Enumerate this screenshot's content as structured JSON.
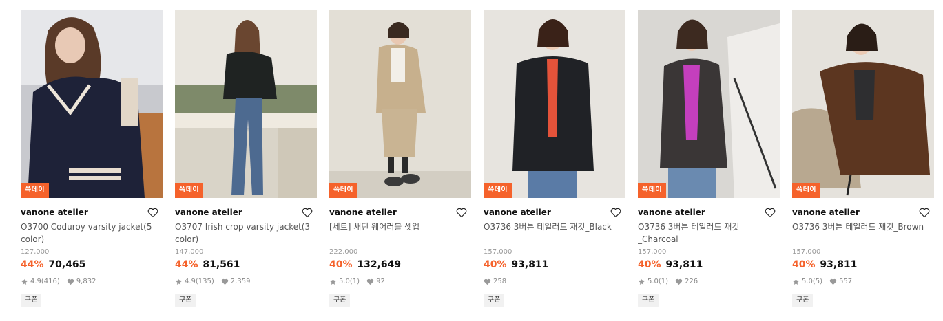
{
  "products": [
    {
      "badge": "쓱데이",
      "brand": "vanone atelier",
      "name": "O3700 Coduroy varsity jacket(5 color)",
      "original_price": "127,000",
      "discount": "44%",
      "price": "70,465",
      "rating": "4.9",
      "reviews": "(416)",
      "likes": "9,832",
      "coupon": "쿠폰"
    },
    {
      "badge": "쓱데이",
      "brand": "vanone atelier",
      "name": "O3707 Irish crop varsity jacket(3 color)",
      "original_price": "147,000",
      "discount": "44%",
      "price": "81,561",
      "rating": "4.9",
      "reviews": "(135)",
      "likes": "2,359",
      "coupon": "쿠폰"
    },
    {
      "badge": "쓱데이",
      "brand": "vanone atelier",
      "name": "[세트] 새틴 웨어러블 셋업",
      "original_price": "222,000",
      "discount": "40%",
      "price": "132,649",
      "rating": "5.0",
      "reviews": "(1)",
      "likes": "92",
      "coupon": "쿠폰"
    },
    {
      "badge": "쓱데이",
      "brand": "vanone atelier",
      "name": "O3736 3버튼 테일러드 재킷_Black",
      "original_price": "157,000",
      "discount": "40%",
      "price": "93,811",
      "rating": "",
      "reviews": "",
      "likes": "258",
      "coupon": "쿠폰"
    },
    {
      "badge": "쓱데이",
      "brand": "vanone atelier",
      "name": "O3736 3버튼 테일러드 재킷 _Charcoal",
      "original_price": "157,000",
      "discount": "40%",
      "price": "93,811",
      "rating": "5.0",
      "reviews": "(1)",
      "likes": "226",
      "coupon": "쿠폰"
    },
    {
      "badge": "쓱데이",
      "brand": "vanone atelier",
      "name": "O3736 3버튼 테일러드 재킷_Brown",
      "original_price": "157,000",
      "discount": "40%",
      "price": "93,811",
      "rating": "5.0",
      "reviews": "(5)",
      "likes": "557",
      "coupon": "쿠폰"
    }
  ],
  "colors": {
    "accent": "#f5622b",
    "text": "#111111",
    "muted": "#888888"
  },
  "icons": {
    "wishlist": "heart-outline-icon",
    "rating": "star-icon",
    "likes": "heart-filled-icon"
  }
}
